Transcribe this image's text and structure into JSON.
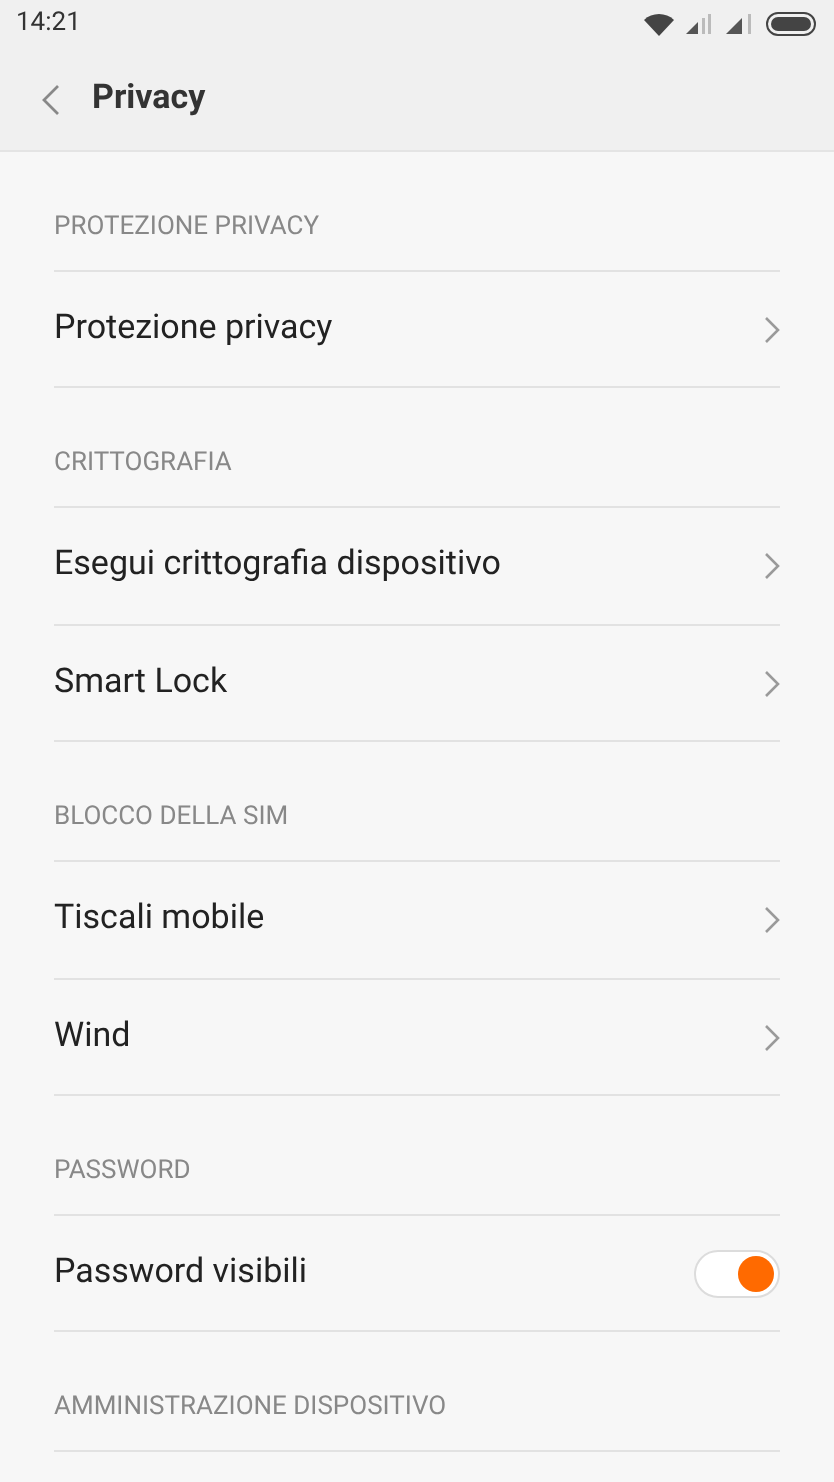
{
  "status_bar": {
    "time": "14:21"
  },
  "header": {
    "title": "Privacy"
  },
  "sections": [
    {
      "title": "PROTEZIONE PRIVACY",
      "items": [
        {
          "label": "Protezione privacy",
          "kind": "link"
        }
      ]
    },
    {
      "title": "CRITTOGRAFIA",
      "items": [
        {
          "label": "Esegui crittografia dispositivo",
          "kind": "link"
        },
        {
          "label": "Smart Lock",
          "kind": "link"
        }
      ]
    },
    {
      "title": "BLOCCO DELLA SIM",
      "items": [
        {
          "label": "Tiscali mobile",
          "kind": "link"
        },
        {
          "label": "Wind",
          "kind": "link"
        }
      ]
    },
    {
      "title": "PASSWORD",
      "items": [
        {
          "label": "Password visibili",
          "kind": "toggle",
          "on": true
        }
      ]
    },
    {
      "title": "AMMINISTRAZIONE DISPOSITIVO"
    }
  ]
}
